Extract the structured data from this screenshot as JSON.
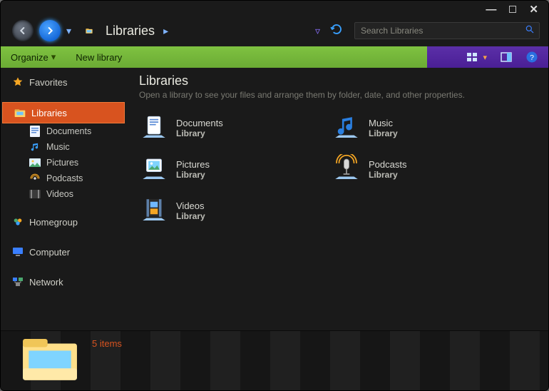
{
  "window": {
    "title": "Libraries"
  },
  "search": {
    "placeholder": "Search Libraries"
  },
  "toolbar": {
    "organize": "Organize",
    "newlib": "New library"
  },
  "sidebar": {
    "favorites": "Favorites",
    "libraries": "Libraries",
    "items": [
      {
        "label": "Documents"
      },
      {
        "label": "Music"
      },
      {
        "label": "Pictures"
      },
      {
        "label": "Podcasts"
      },
      {
        "label": "Videos"
      }
    ],
    "homegroup": "Homegroup",
    "computer": "Computer",
    "network": "Network"
  },
  "main": {
    "heading": "Libraries",
    "subheading": "Open a library to see your files and arrange them by folder, date, and other properties.",
    "library_word": "Library",
    "libs": [
      {
        "name": "Documents",
        "icon": "documents"
      },
      {
        "name": "Music",
        "icon": "music"
      },
      {
        "name": "Pictures",
        "icon": "pictures"
      },
      {
        "name": "Podcasts",
        "icon": "podcasts"
      },
      {
        "name": "Videos",
        "icon": "videos"
      }
    ]
  },
  "details": {
    "count_text": "5 items"
  }
}
